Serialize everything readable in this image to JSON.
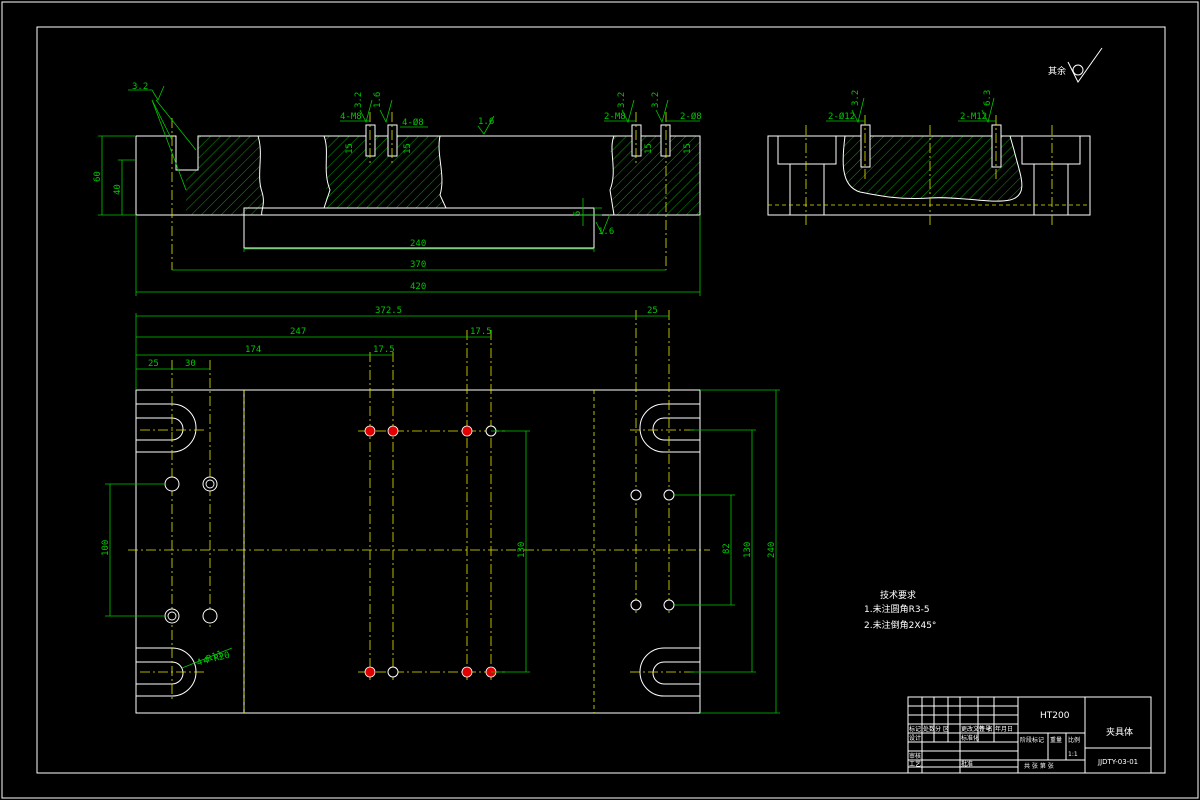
{
  "drawing": {
    "roughness_rest": "其余",
    "tech_req": {
      "title": "技术要求",
      "item1": "1.未注圆角R3-5",
      "item2": "2.未注倒角2X45°"
    },
    "section_labels": {
      "m8_left": "4-M8",
      "d8_left": "4-Ø8",
      "m8_right": "2-M8",
      "d8_right": "2-Ø8",
      "d12": "2-Ø12",
      "m12": "2-M12"
    },
    "roughness": {
      "r1": "3.2",
      "r2": "1.6",
      "r3": "3.2",
      "r4": "3.2",
      "r5": "1.6",
      "r6": "3.2",
      "r7": "3.2",
      "r8": "3.2",
      "r9": "1.6",
      "r10": "6.3",
      "r11": "3.2"
    },
    "dims_top": {
      "h60": "60",
      "h40": "40",
      "d240": "240",
      "d370": "370",
      "d420": "420",
      "d5": "5",
      "d15a": "15",
      "d15b": "15",
      "d15c": "15",
      "d15d": "15"
    },
    "dims_plan": {
      "d372_5": "372.5",
      "d247": "247",
      "d174": "174",
      "d17_5a": "17.5",
      "d17_5b": "17.5",
      "d25a": "25",
      "d30": "30",
      "d25b": "25",
      "d100": "100",
      "d130a": "130",
      "d82": "82",
      "d130b": "130",
      "d240": "240",
      "r11": "4-R11",
      "r20": "4-R20"
    }
  },
  "title_block": {
    "material": "HT200",
    "part_name": "夹具体",
    "drawing_no": "JJDTY-03-01",
    "labels": {
      "mark": "标记",
      "count": "处数",
      "zone": "分 区",
      "change_no": "更改文件号",
      "sign": "签 名",
      "date": "年月日",
      "design": "设计",
      "standard": "标准化",
      "stage_mark": "阶段标记",
      "weight": "重量",
      "scale": "比例",
      "ratio": "1:1",
      "review": "审核",
      "process": "工艺",
      "approve": "批准",
      "sheets": "共 张 第 张"
    }
  }
}
